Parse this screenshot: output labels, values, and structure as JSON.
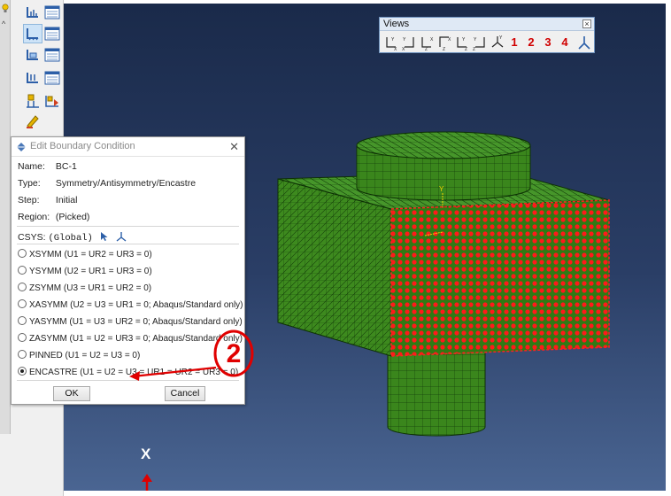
{
  "views_panel": {
    "title": "Views",
    "close_label": "×",
    "preset_labels": [
      "1",
      "2",
      "3",
      "4"
    ],
    "buttons": [
      "front-view",
      "back-view",
      "top-view",
      "bottom-view",
      "left-view",
      "right-view",
      "iso-view"
    ]
  },
  "dialog": {
    "title": "Edit Boundary Condition",
    "close_label": "✕",
    "name_label": "Name:",
    "name_value": "BC-1",
    "type_label": "Type:",
    "type_value": "Symmetry/Antisymmetry/Encastre",
    "step_label": "Step:",
    "step_value": "Initial",
    "region_label": "Region:",
    "region_value": "(Picked)",
    "csys_label": "CSYS:",
    "csys_value": "(Global)",
    "options": [
      {
        "label": "XSYMM (U1 = UR2 = UR3 = 0)",
        "selected": false
      },
      {
        "label": "YSYMM (U2 = UR1 = UR3 = 0)",
        "selected": false
      },
      {
        "label": "ZSYMM (U3 = UR1 = UR2 = 0)",
        "selected": false
      },
      {
        "label": "XASYMM (U2 = U3 = UR1 = 0; Abaqus/Standard only)",
        "selected": false
      },
      {
        "label": "YASYMM (U1 = U3 = UR2 = 0; Abaqus/Standard only)",
        "selected": false
      },
      {
        "label": "ZASYMM (U1 = U2 = UR3 = 0; Abaqus/Standard only)",
        "selected": false
      },
      {
        "label": "PINNED (U1 = U2 = U3 = 0)",
        "selected": false
      },
      {
        "label": "ENCASTRE (U1 = U2 = U3 = UR1 = UR2 = UR3 = 0)",
        "selected": true
      }
    ],
    "ok_label": "OK",
    "cancel_label": "Cancel"
  },
  "annotation": {
    "step_number": "2",
    "color": "#e00000"
  },
  "viewport": {
    "axis_label": "X",
    "model_color": "#3d8a1e",
    "picked_face_color": "#e01010",
    "background_top": "#1a2a4a",
    "background_bottom": "#4a6592"
  }
}
